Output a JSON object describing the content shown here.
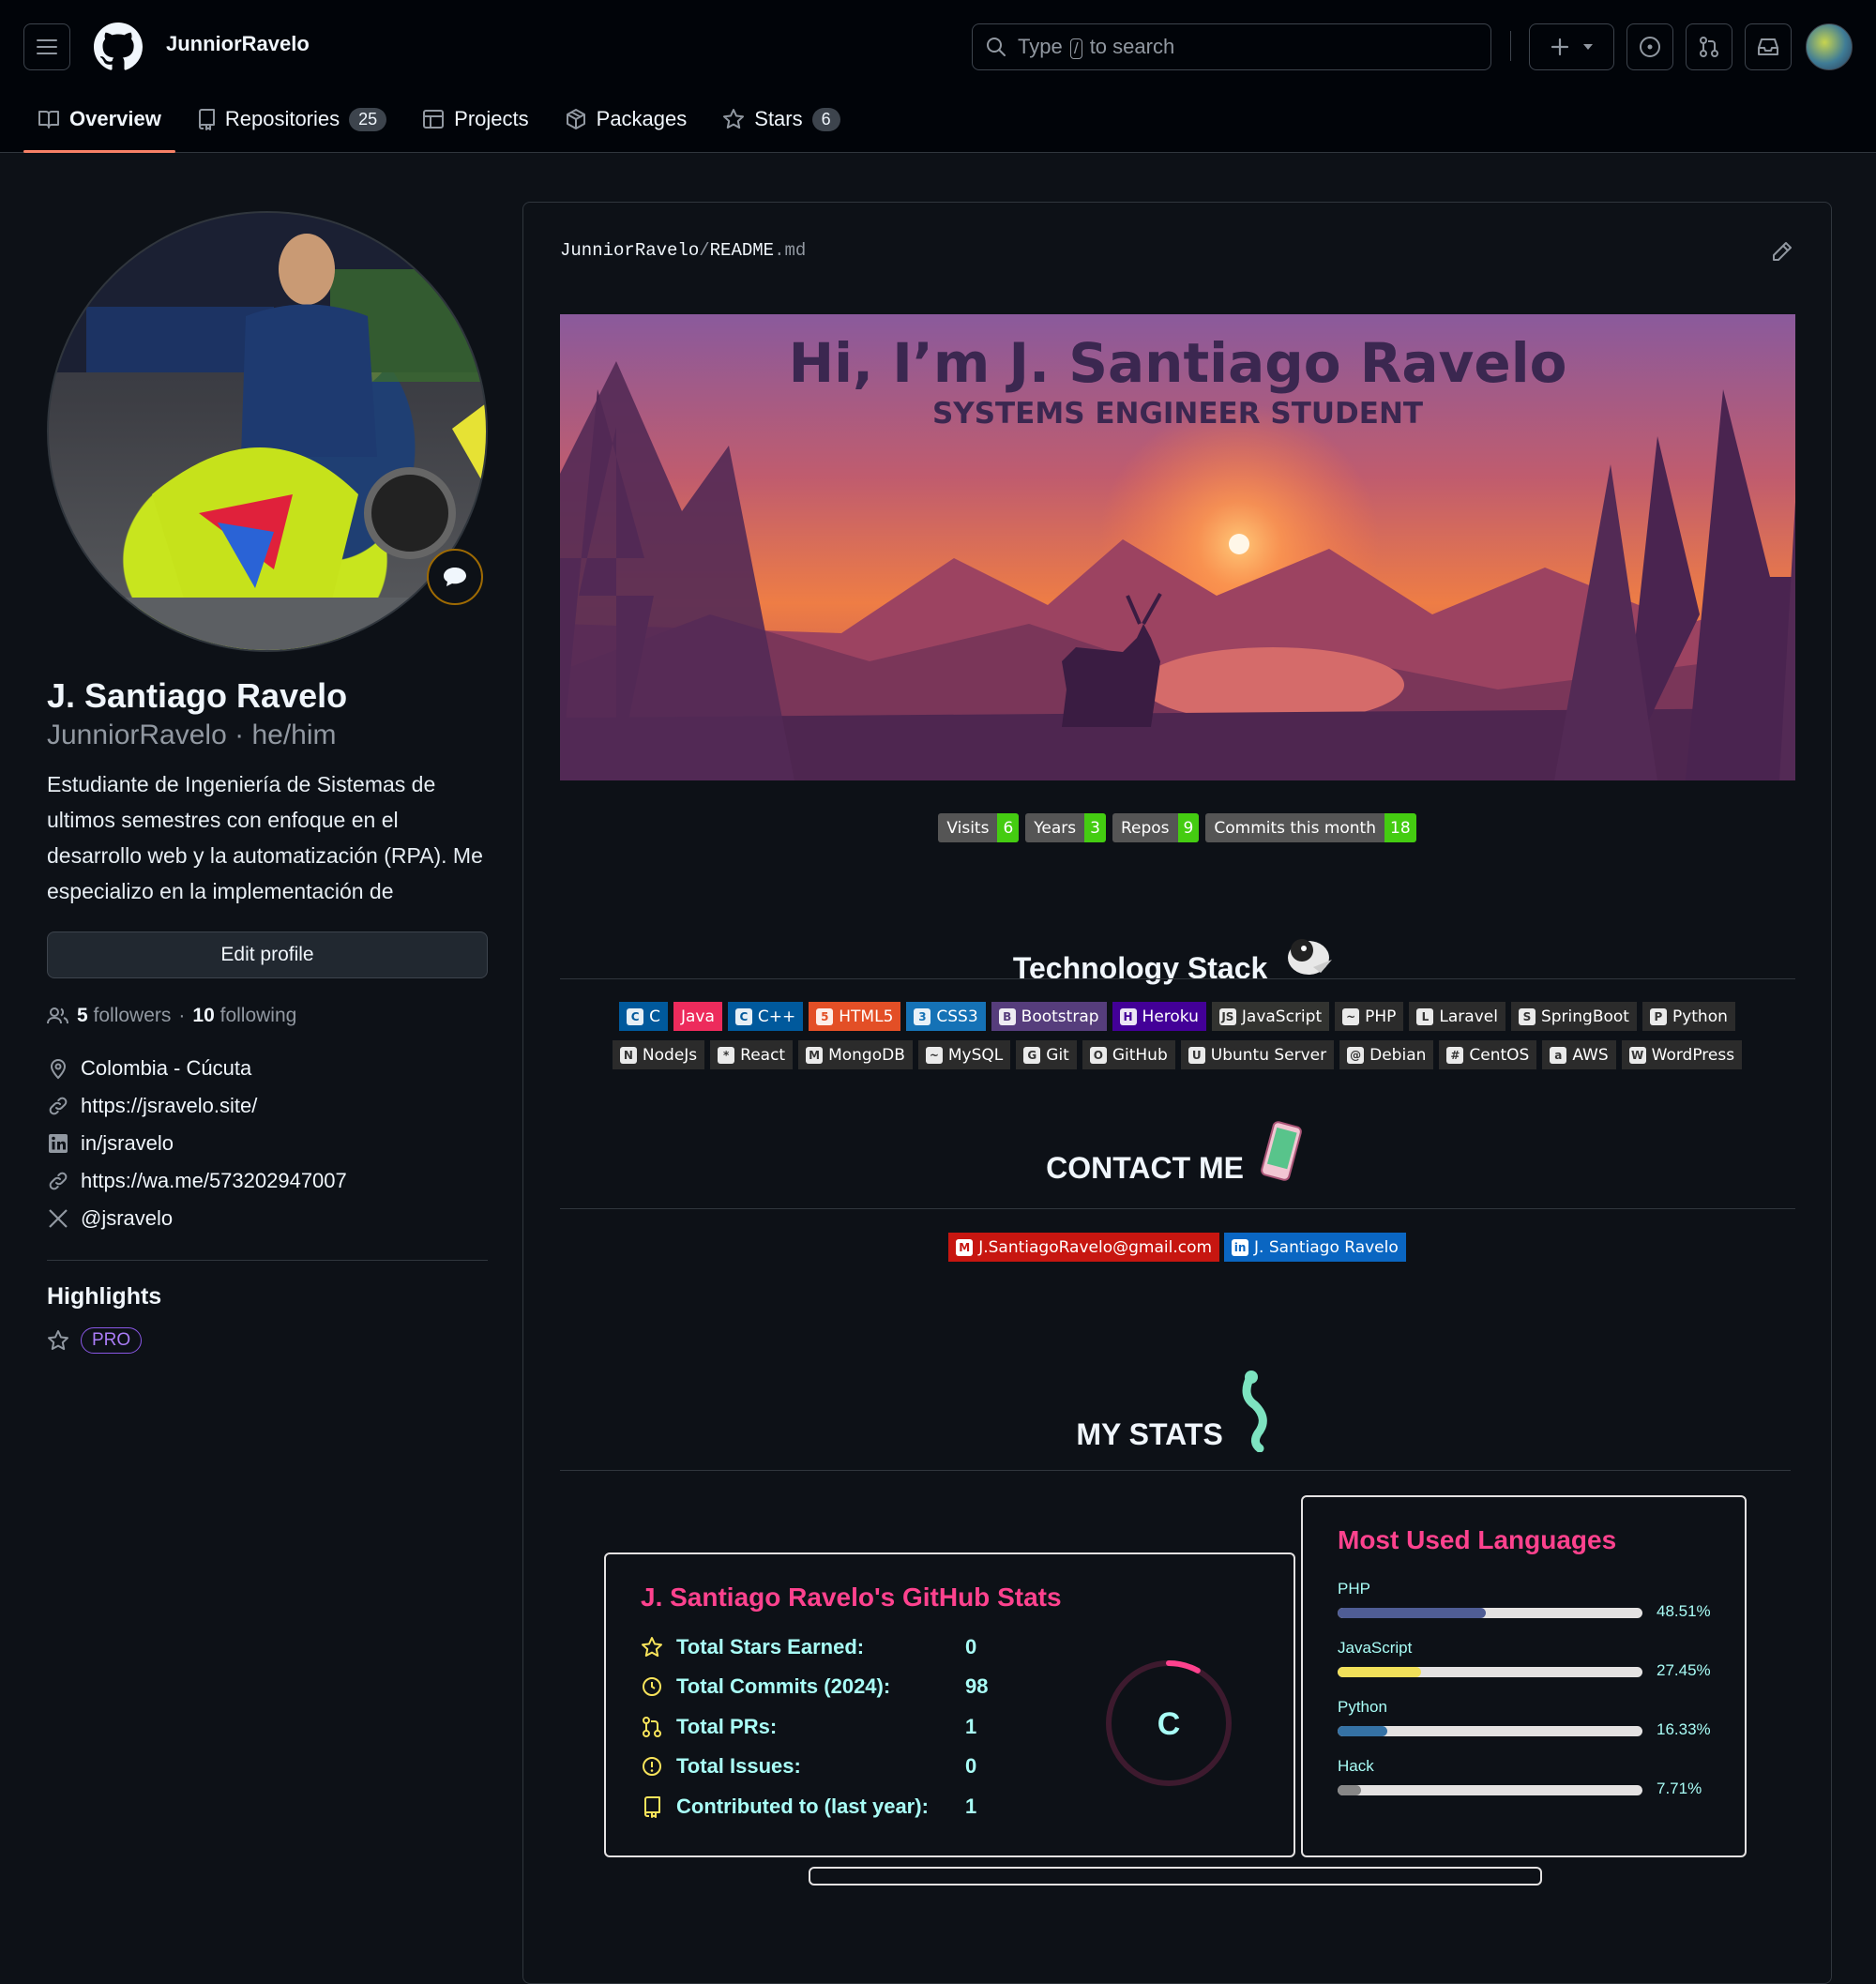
{
  "header": {
    "username": "JunniorRavelo",
    "search": {
      "prefix": "Type",
      "key": "/",
      "suffix": "to search"
    },
    "plus_label": "+"
  },
  "tabs": [
    {
      "label": "Overview",
      "icon": "book-icon"
    },
    {
      "label": "Repositories",
      "count": "25",
      "icon": "repo-icon"
    },
    {
      "label": "Projects",
      "icon": "table-icon"
    },
    {
      "label": "Packages",
      "icon": "package-icon"
    },
    {
      "label": "Stars",
      "count": "6",
      "icon": "star-icon"
    }
  ],
  "profile": {
    "name": "J. Santiago Ravelo",
    "login": "JunniorRavelo",
    "pronouns": "he/him",
    "bio": "Estudiante de Ingeniería de Sistemas de ultimos semestres con enfoque en el desarrollo web y la automatización (RPA). Me especializo en la implementación de",
    "edit_label": "Edit profile",
    "followers_count": "5",
    "followers_label": "followers",
    "following_count": "10",
    "following_label": "following",
    "location": "Colombia - Cúcuta",
    "website": "https://jsravelo.site/",
    "linkedin": "in/jsravelo",
    "whatsapp": "https://wa.me/573202947007",
    "twitter": "@jsravelo"
  },
  "highlights": {
    "title": "Highlights",
    "pro": "PRO"
  },
  "readme": {
    "owner": "JunniorRavelo",
    "sep": "/",
    "file": "README",
    "ext": ".md",
    "banner_title": "Hi, I’m J. Santiago Ravelo",
    "banner_subtitle": "SYSTEMS ENGINEER STUDENT",
    "badges": [
      {
        "label": "Visits",
        "value": "6"
      },
      {
        "label": "Years",
        "value": "3"
      },
      {
        "label": "Repos",
        "value": "9"
      },
      {
        "label": "Commits this month",
        "value": "18"
      }
    ],
    "tech_title": "Technology Stack",
    "tech_row1": [
      {
        "label": "C",
        "bg": "#00599c",
        "icon": "C"
      },
      {
        "label": "Java",
        "bg": "#ed2b5c",
        "icon": ""
      },
      {
        "label": "C++",
        "bg": "#00599c",
        "icon": "C"
      },
      {
        "label": "HTML5",
        "bg": "#e34f26",
        "icon": "5"
      },
      {
        "label": "CSS3",
        "bg": "#1572b6",
        "icon": "3"
      },
      {
        "label": "Bootstrap",
        "bg": "#563d7c",
        "icon": "B"
      },
      {
        "label": "Heroku",
        "bg": "#430098",
        "icon": "H"
      },
      {
        "label": "JavaScript",
        "bg": "#323330",
        "icon": "JS"
      },
      {
        "label": "PHP",
        "bg": "#2b2b2b",
        "icon": "~"
      },
      {
        "label": "Laravel",
        "bg": "#2b2b2b",
        "icon": "L"
      },
      {
        "label": "SpringBoot",
        "bg": "#2b2b2b",
        "icon": "S"
      },
      {
        "label": "Python",
        "bg": "#2b2b2b",
        "icon": "P"
      }
    ],
    "tech_row2": [
      {
        "label": "NodeJs",
        "bg": "#2b2b2b",
        "icon": "N"
      },
      {
        "label": "React",
        "bg": "#2b2b2b",
        "icon": "*"
      },
      {
        "label": "MongoDB",
        "bg": "#2b2b2b",
        "icon": "M"
      },
      {
        "label": "MySQL",
        "bg": "#2b2b2b",
        "icon": "~"
      },
      {
        "label": "Git",
        "bg": "#2b2b2b",
        "icon": "G"
      },
      {
        "label": "GitHub",
        "bg": "#2b2b2b",
        "icon": "O"
      },
      {
        "label": "Ubuntu Server",
        "bg": "#2b2b2b",
        "icon": "U"
      },
      {
        "label": "Debian",
        "bg": "#2b2b2b",
        "icon": "@"
      },
      {
        "label": "CentOS",
        "bg": "#2b2b2b",
        "icon": "#"
      },
      {
        "label": "AWS",
        "bg": "#2b2b2b",
        "icon": "a"
      },
      {
        "label": "WordPress",
        "bg": "#2b2b2b",
        "icon": "W"
      }
    ],
    "contact_title": "CONTACT ME",
    "contact": [
      {
        "label": "J.SantiagoRavelo@gmail.com",
        "bg": "#c71610",
        "icon": "M"
      },
      {
        "label": "J. Santiago Ravelo",
        "bg": "#0a66c2",
        "icon": "in"
      }
    ],
    "stats_title": "MY STATS"
  },
  "stats_card": {
    "title": "J. Santiago Ravelo's GitHub Stats",
    "rows": [
      {
        "label": "Total Stars Earned:",
        "value": "0",
        "icon": "star-icon"
      },
      {
        "label": "Total Commits (2024):",
        "value": "98",
        "icon": "history-icon"
      },
      {
        "label": "Total PRs:",
        "value": "1",
        "icon": "pull-request-icon"
      },
      {
        "label": "Total Issues:",
        "value": "0",
        "icon": "issue-icon"
      },
      {
        "label": "Contributed to (last year):",
        "value": "1",
        "icon": "repo-icon"
      }
    ],
    "rank": "C",
    "rank_progress": 0.08
  },
  "languages_card": {
    "title": "Most Used Languages",
    "langs": [
      {
        "name": "PHP",
        "pct": "48.51%",
        "value": 48.51,
        "color": "#4F5D95"
      },
      {
        "name": "JavaScript",
        "pct": "27.45%",
        "value": 27.45,
        "color": "#f1e05a"
      },
      {
        "name": "Python",
        "pct": "16.33%",
        "value": 16.33,
        "color": "#3572A5"
      },
      {
        "name": "Hack",
        "pct": "7.71%",
        "value": 7.71,
        "color": "#878787"
      }
    ]
  },
  "colors": {
    "accent_tab": "#f78166",
    "card_title": "#fe428e",
    "card_text": "#a9fef7"
  }
}
